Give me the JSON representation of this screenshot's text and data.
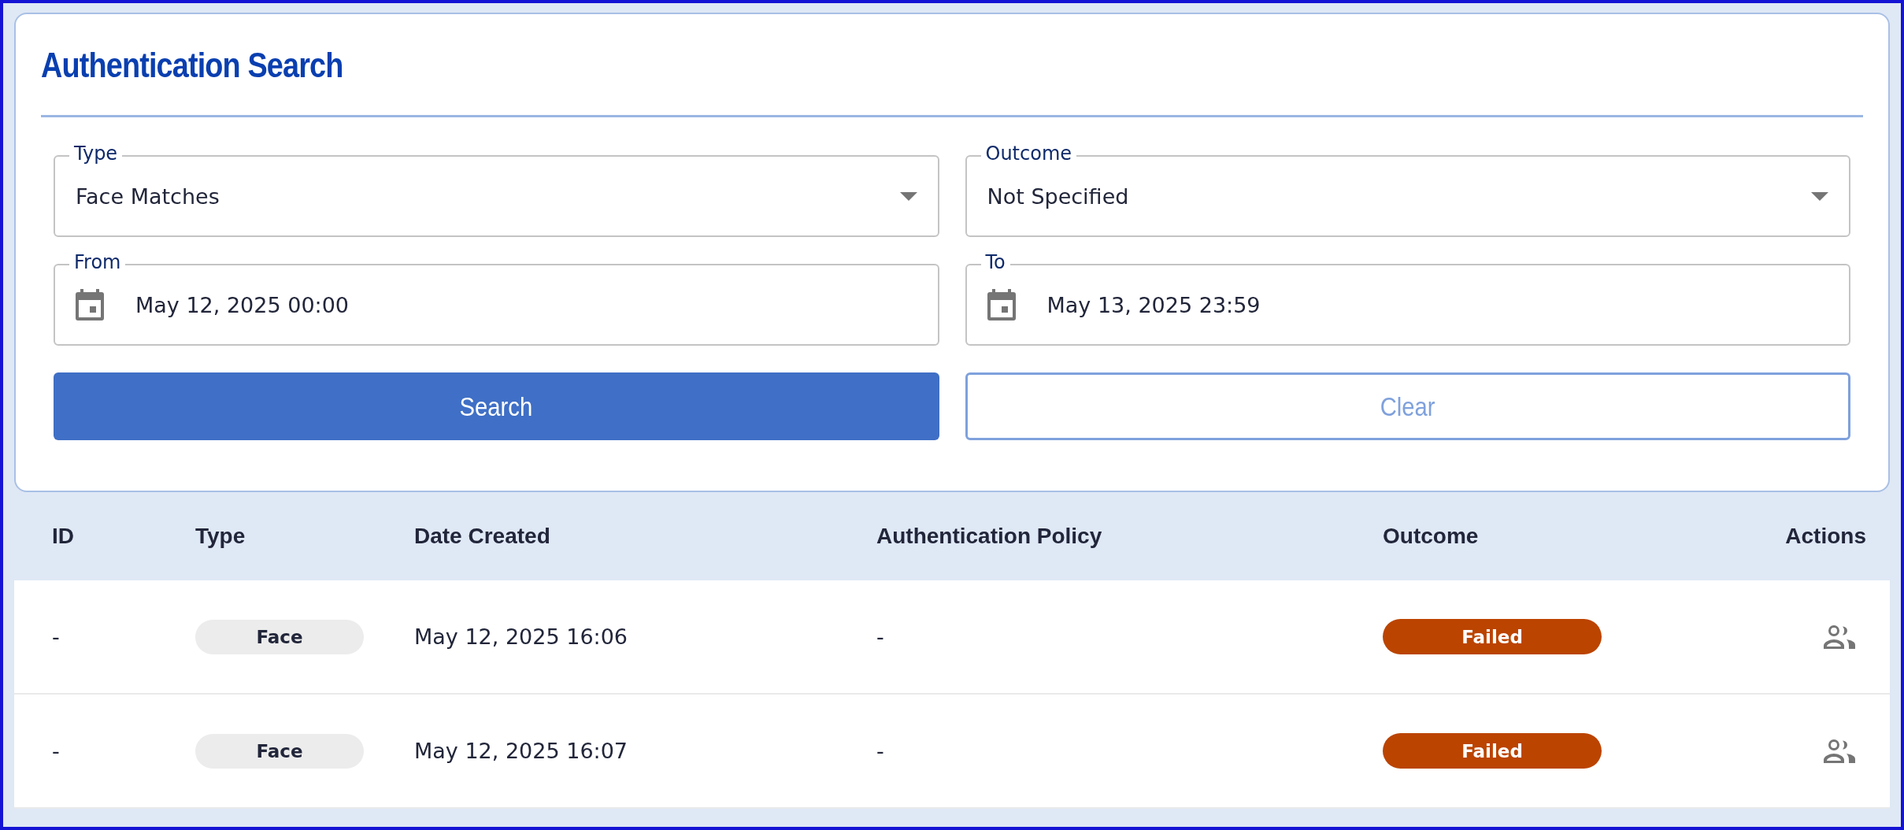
{
  "search_panel": {
    "title": "Authentication Search",
    "fields": [
      {
        "kind": "select",
        "label": "Type",
        "value": "Face Matches"
      },
      {
        "kind": "select",
        "label": "Outcome",
        "value": "Not Specified"
      },
      {
        "kind": "date",
        "label": "From",
        "value": "May 12, 2025 00:00"
      },
      {
        "kind": "date",
        "label": "To",
        "value": "May 13, 2025 23:59"
      }
    ],
    "buttons": [
      {
        "label": "Search",
        "kind": "primary"
      },
      {
        "label": "Clear",
        "kind": "outline"
      }
    ]
  },
  "table": {
    "columns": [
      "ID",
      "Type",
      "Date Created",
      "Authentication Policy",
      "Outcome",
      "Actions"
    ],
    "rows": [
      {
        "id": "-",
        "type": "Face",
        "date_created": "May 12, 2025 16:06",
        "authentication_policy": "-",
        "outcome": "Failed",
        "color": "#bb4400"
      },
      {
        "id": "-",
        "type": "Face",
        "date_created": "May 12, 2025 16:07",
        "authentication_policy": "-",
        "outcome": "Failed",
        "color": "#bb4400"
      }
    ]
  }
}
